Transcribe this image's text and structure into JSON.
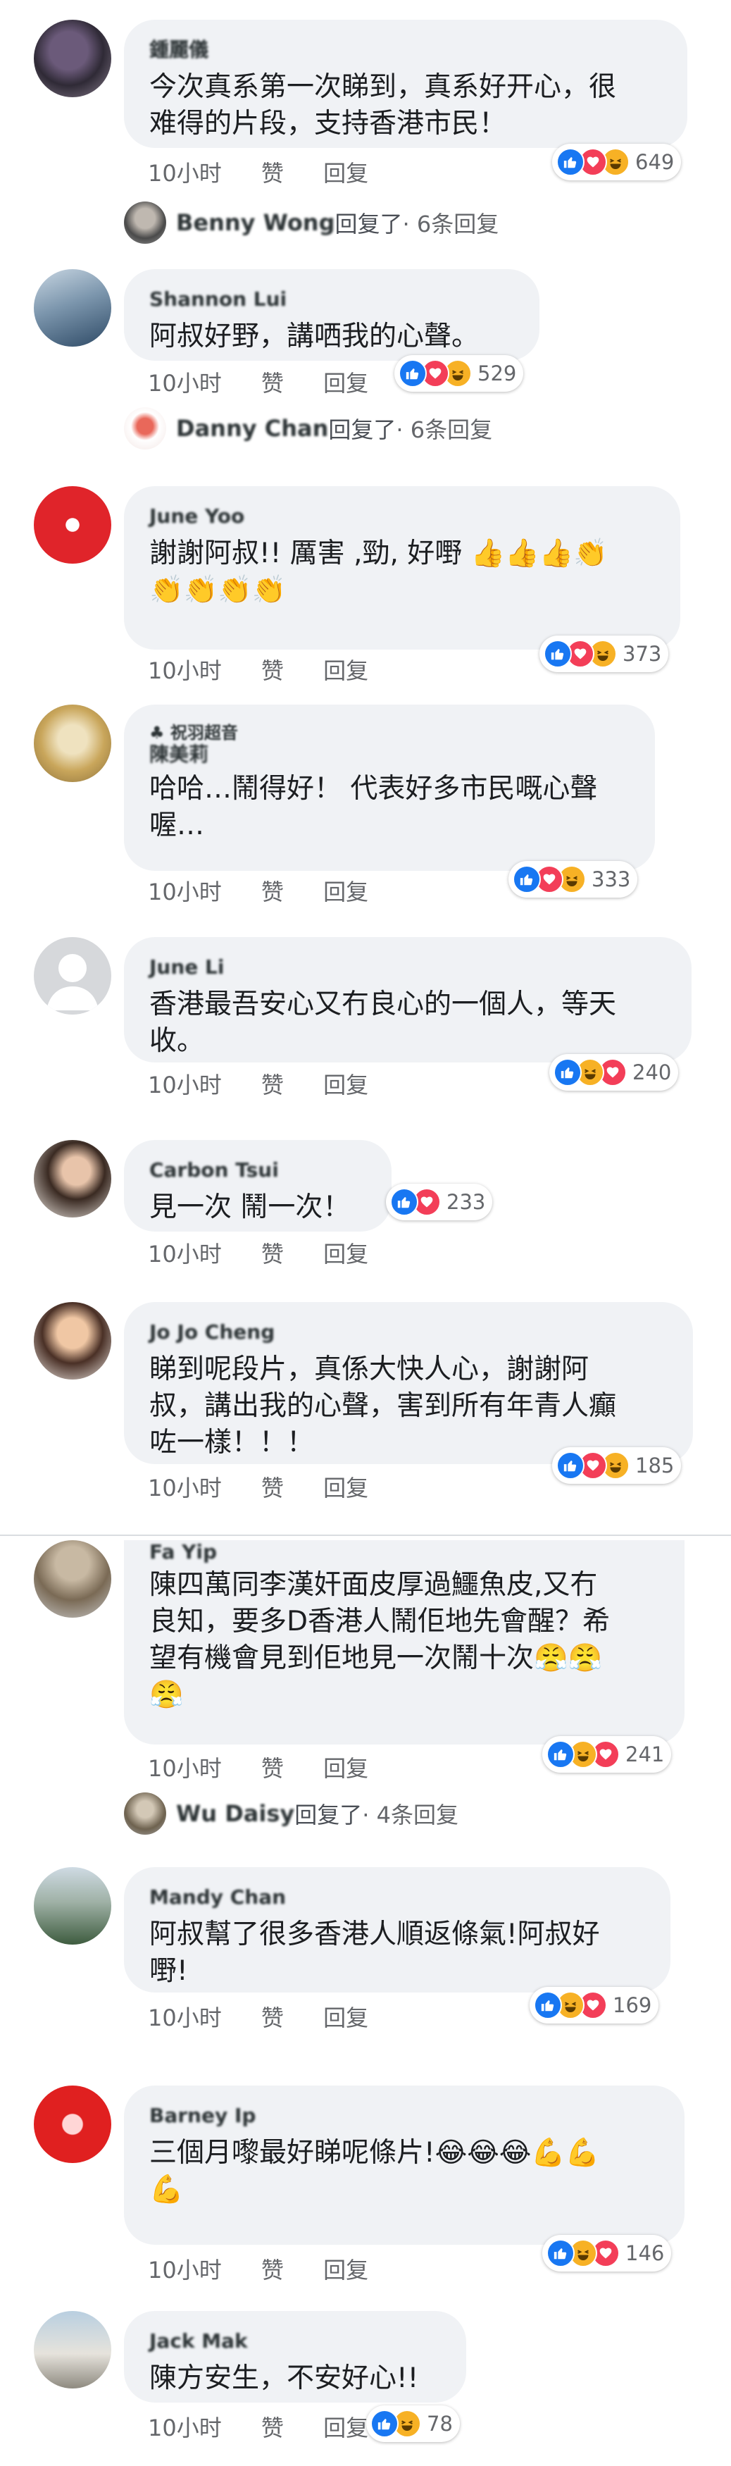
{
  "colors": {
    "like": "#1877f2",
    "love": "#f33e58",
    "haha": "#f7b125",
    "bubble": "#f0f2f5",
    "meta": "#65676b"
  },
  "meta_labels": {
    "time": "10小时",
    "like": "赞",
    "reply": "回复"
  },
  "comments": [
    {
      "author": "鍾麗儀",
      "text": "今次真系第一次睇到，真系好开心，很\n难得的片段，支持香港市民！",
      "reactions": [
        "like",
        "love",
        "haha"
      ],
      "count": "649",
      "reply": {
        "name": "Benny Wong",
        "action": "回复了",
        "count": " · 6条回复"
      }
    },
    {
      "author": "Shannon Lui",
      "text": "阿叔好野，講哂我的心聲。",
      "reactions": [
        "like",
        "love",
        "haha"
      ],
      "count": "529",
      "reply": {
        "name": "Danny Chan",
        "action": "回复了",
        "count": " · 6条回复"
      }
    },
    {
      "author": "June Yoo",
      "text": "謝謝阿叔!! 厲害 ,勁, 好嘢 👍👍👍👏\n👏👏👏👏",
      "reactions": [
        "like",
        "love",
        "haha"
      ],
      "count": "373"
    },
    {
      "sub_author": "♣ 祝羽超音",
      "author": "陳美莉",
      "text": "哈哈…鬧得好！ 代表好多市民嘅心聲\n喔…",
      "reactions": [
        "like",
        "love",
        "haha"
      ],
      "count": "333"
    },
    {
      "author": "June Li",
      "text": "香港最吾安心又冇良心的一個人，等天\n收。",
      "reactions": [
        "like",
        "haha",
        "love"
      ],
      "count": "240"
    },
    {
      "author": "Carbon Tsui",
      "text": "見一次 鬧一次！",
      "reactions": [
        "like",
        "love"
      ],
      "count": "233"
    },
    {
      "author": "Jo Jo Cheng",
      "text": "睇到呢段片，真係大快人心，謝謝阿\n叔，講出我的心聲，害到所有年青人癲\n咗一樣！！！",
      "reactions": [
        "like",
        "love",
        "haha"
      ],
      "count": "185"
    },
    {
      "author": "Fa Yip",
      "text": "陳四萬同李漢奸面皮厚過鱷魚皮,又冇\n良知，要多D香港人鬧佢地先會醒？希\n望有機會見到佢地見一次鬧十次😤😤\n😤",
      "reactions": [
        "like",
        "haha",
        "love"
      ],
      "count": "241",
      "reply": {
        "name": "Wu Daisy",
        "action": "回复了",
        "count": " · 4条回复"
      }
    },
    {
      "author": "Mandy Chan",
      "text": "阿叔幫了很多香港人順返條氣!阿叔好\n嘢!",
      "reactions": [
        "like",
        "haha",
        "love"
      ],
      "count": "169"
    },
    {
      "author": "Barney Ip",
      "text": "三個月嚟最好睇呢條片!😂😂😂💪💪\n💪",
      "reactions": [
        "like",
        "haha",
        "love"
      ],
      "count": "146"
    },
    {
      "author": "Jack Mak",
      "text": "陳方安生，不安好心!!",
      "reactions": [
        "like",
        "haha"
      ],
      "count": "78"
    }
  ]
}
